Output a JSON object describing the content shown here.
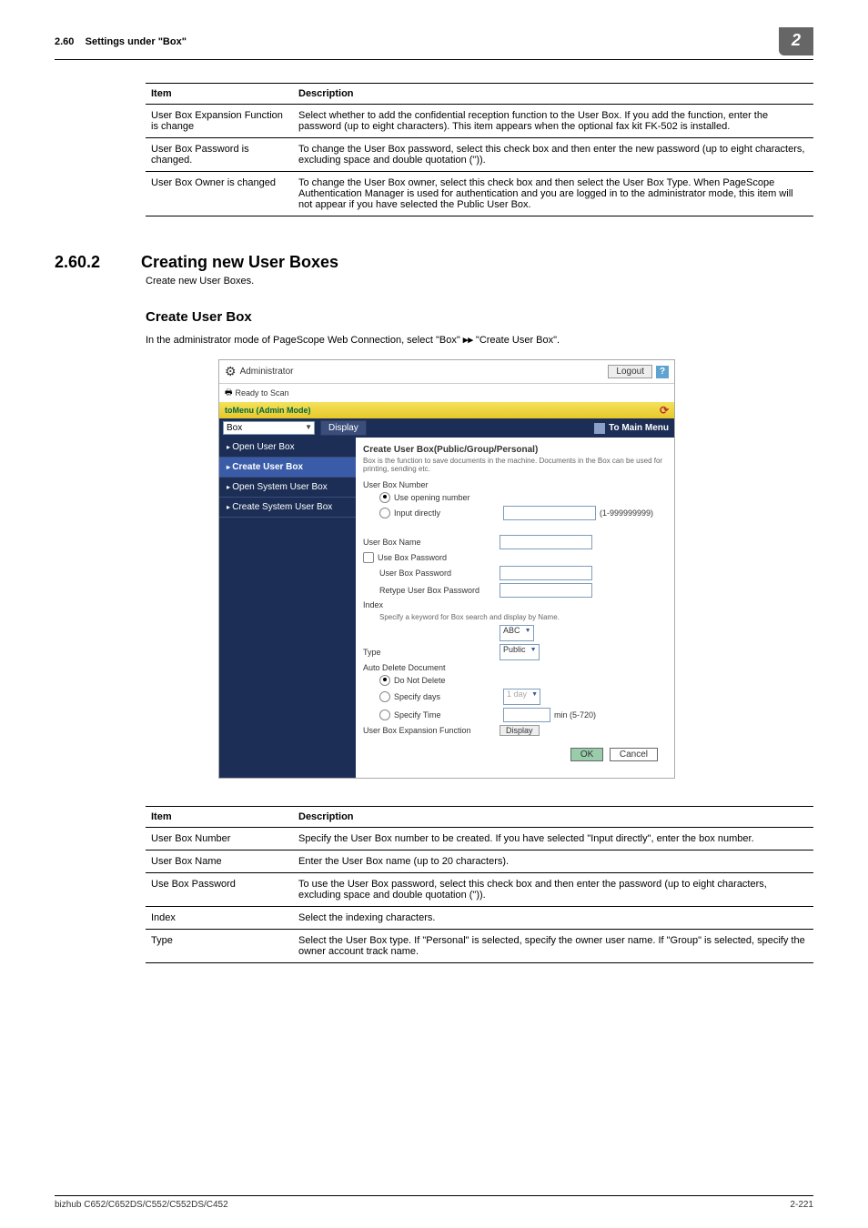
{
  "header": {
    "section": "2.60",
    "title": "Settings under \"Box\"",
    "chapter": "2"
  },
  "table1": {
    "head_item": "Item",
    "head_desc": "Description",
    "rows": [
      {
        "item": "User Box Expansion Function is change",
        "desc": "Select whether to add the confidential reception function to the User Box. If you add the function, enter the password (up to eight characters). This item appears when the optional fax kit FK-502 is installed."
      },
      {
        "item": "User Box Password is changed.",
        "desc": "To change the User Box password, select this check box and then enter the new password (up to eight characters, excluding space and double quotation (\"))."
      },
      {
        "item": "User Box Owner is changed",
        "desc": "To change the User Box owner, select this check box and then select the User Box Type. When PageScope Authentication Manager is used for authentication and you are logged in to the administrator mode, this item will not appear if you have selected the Public User Box."
      }
    ]
  },
  "section": {
    "number": "2.60.2",
    "title": "Creating new User Boxes",
    "intro": "Create new User Boxes."
  },
  "subsection": {
    "title": "Create User Box",
    "intro_pre": "In the administrator mode of PageScope Web Connection, select \"Box\" ",
    "intro_post": " \"Create User Box\"."
  },
  "screenshot": {
    "top": {
      "admin": "Administrator",
      "logout": "Logout"
    },
    "status": {
      "ready": "Ready to Scan",
      "admin_mode": "toMenu (Admin Mode)"
    },
    "nav": {
      "box": "Box",
      "display": "Display",
      "to_main": "To Main Menu"
    },
    "side": {
      "open_user": "Open User Box",
      "create_user": "Create User Box",
      "open_system": "Open System User Box",
      "create_system": "Create System User Box"
    },
    "main": {
      "title": "Create User Box(Public/Group/Personal)",
      "desc": "Box is the function to save documents in the machine. Documents in the Box can be used for printing, sending etc.",
      "user_box_number": "User Box Number",
      "use_opening": "Use opening number",
      "input_directly": "Input directly",
      "range": "(1-999999999)",
      "user_box_name": "User Box Name",
      "use_box_pw": "Use Box Password",
      "user_box_pw": "User Box Password",
      "retype_pw": "Retype User Box Password",
      "index": "Index",
      "index_note": "Specify a keyword for Box search and display by Name.",
      "index_val": "ABC",
      "type": "Type",
      "type_val": "Public",
      "auto_delete": "Auto Delete Document",
      "do_not_delete": "Do Not Delete",
      "specify_days": "Specify days",
      "days_val": "1 day",
      "specify_time": "Specify Time",
      "time_unit": "min (5-720)",
      "expansion": "User Box Expansion Function",
      "display_btn": "Display",
      "ok": "OK",
      "cancel": "Cancel"
    }
  },
  "table2": {
    "head_item": "Item",
    "head_desc": "Description",
    "rows": [
      {
        "item": "User Box Number",
        "desc": "Specify the User Box number to be created. If you have selected \"Input directly\", enter the box number."
      },
      {
        "item": "User Box Name",
        "desc": "Enter the User Box name (up to 20 characters)."
      },
      {
        "item": "Use Box Password",
        "desc": "To use the User Box password, select this check box and then enter the password (up to eight characters, excluding space and double quotation (\"))."
      },
      {
        "item": "Index",
        "desc": "Select the indexing characters."
      },
      {
        "item": "Type",
        "desc": "Select the User Box type. If \"Personal\" is selected, specify the owner user name. If \"Group\" is selected, specify the owner account track name."
      }
    ]
  },
  "footer": {
    "left": "bizhub C652/C652DS/C552/C552DS/C452",
    "right": "2-221"
  }
}
